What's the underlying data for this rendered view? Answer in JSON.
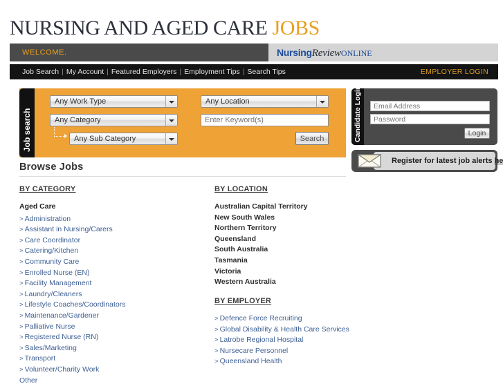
{
  "masthead": {
    "title_dark": "NURSING AND AGED CARE",
    "title_gold": "JOBS"
  },
  "welcome_bar": {
    "welcome_text": "WELCOME.",
    "logo": {
      "part1": "Nursing",
      "part2": "Review",
      "part3": "ONLINE"
    }
  },
  "nav": {
    "items": [
      "Job Search",
      "My Account",
      "Featured Employers",
      "Employment Tips",
      "Search Tips"
    ],
    "separator": "|",
    "employer_login": "EMPLOYER LOGIN"
  },
  "job_search": {
    "tab_label": "Job search",
    "work_type": "Any Work Type",
    "category": "Any Category",
    "sub_category": "Any Sub Category",
    "location": "Any Location",
    "keyword_placeholder": "Enter Keyword(s)",
    "keyword_value": "",
    "search_label": "Search",
    "panel_color": "#efa236"
  },
  "candidate_login": {
    "tab_label": "Candidate Login",
    "email_placeholder": "Email Address",
    "email_value": "",
    "password_placeholder": "Password",
    "password_value": "",
    "login_label": "Login"
  },
  "register_banner": {
    "text": "Register for latest job alerts",
    "link_label": "here",
    "icon": "envelope-icon"
  },
  "browse": {
    "heading": "Browse Jobs",
    "by_category_heading": "BY CATEGORY",
    "by_location_heading": "BY LOCATION",
    "by_employer_heading": "BY EMPLOYER",
    "category_group": "Aged Care",
    "categories": [
      "Administration",
      "Assistant in Nursing/Carers",
      "Care Coordinator",
      "Catering/Kitchen",
      "Community Care",
      "Enrolled Nurse (EN)",
      "Facility Management",
      "Laundry/Cleaners",
      "Lifestyle Coaches/Coordinators",
      "Maintenance/Gardener",
      "Palliative Nurse",
      "Registered Nurse (RN)",
      "Sales/Marketing",
      "Transport",
      "Volunteer/Charity Work"
    ],
    "category_trailing": "Other",
    "locations": [
      "Australian Capital Territory",
      "New South Wales",
      "Northern Territory",
      "Queensland",
      "South Australia",
      "Tasmania",
      "Victoria",
      "Western Australia"
    ],
    "employers": [
      "Defence Force Recruiting",
      "Global Disability & Health Care Services",
      "Latrobe Regional Hospital",
      "Nursecare Personnel",
      "Queensland Health"
    ],
    "bullet": ">"
  },
  "colors": {
    "accent_gold": "#e8a020",
    "link_blue": "#3f6094",
    "panel_orange": "#efa236",
    "dark_gray": "#4a4a4a",
    "nav_black": "#141414"
  }
}
